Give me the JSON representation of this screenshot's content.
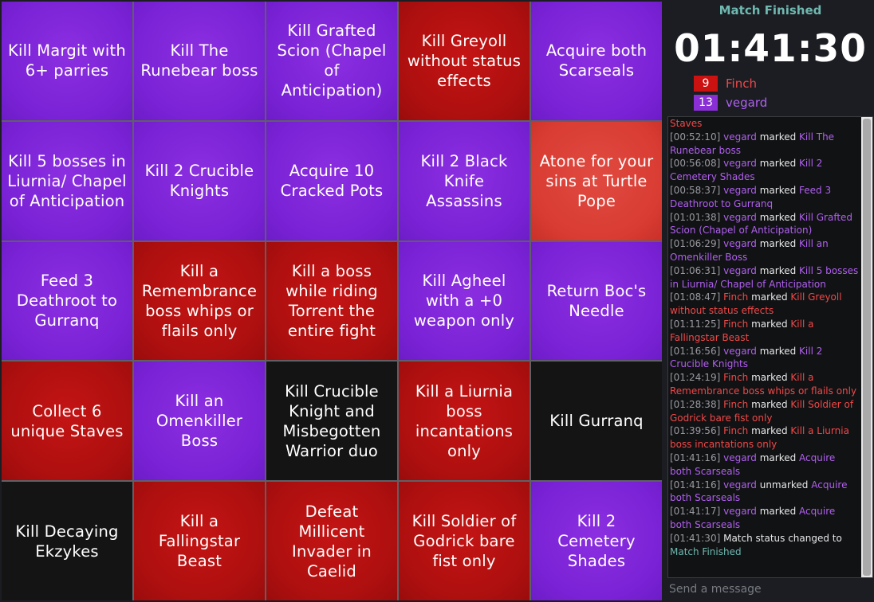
{
  "board": {
    "cells": [
      {
        "text": "Kill Margit with 6+ parries",
        "color": "purple"
      },
      {
        "text": "Kill The Runebear boss",
        "color": "purple"
      },
      {
        "text": "Kill Grafted Scion (Chapel of Anticipation)",
        "color": "purple"
      },
      {
        "text": "Kill Greyoll without status effects",
        "color": "red"
      },
      {
        "text": "Acquire both Scarseals",
        "color": "purple"
      },
      {
        "text": "Kill 5 bosses in Liurnia/ Chapel of Anticipation",
        "color": "purple"
      },
      {
        "text": "Kill 2 Crucible Knights",
        "color": "purple"
      },
      {
        "text": "Acquire 10 Cracked Pots",
        "color": "purple"
      },
      {
        "text": "Kill 2 Black Knife Assassins",
        "color": "purple"
      },
      {
        "text": "Atone for your sins at Turtle Pope",
        "color": "red-light"
      },
      {
        "text": "Feed 3 Deathroot to Gurranq",
        "color": "purple"
      },
      {
        "text": "Kill a Remembrance boss whips or flails only",
        "color": "red"
      },
      {
        "text": "Kill a boss while riding Torrent the entire fight",
        "color": "red"
      },
      {
        "text": "Kill Agheel with a +0 weapon only",
        "color": "purple"
      },
      {
        "text": "Return Boc's Needle",
        "color": "purple"
      },
      {
        "text": "Collect 6 unique Staves",
        "color": "red"
      },
      {
        "text": "Kill an Omenkiller Boss",
        "color": "purple"
      },
      {
        "text": "Kill Crucible Knight and Misbegotten Warrior duo",
        "color": "dark"
      },
      {
        "text": "Kill a Liurnia boss incantations only",
        "color": "red"
      },
      {
        "text": "Kill Gurranq",
        "color": "dark"
      },
      {
        "text": "Kill Decaying Ekzykes",
        "color": "dark"
      },
      {
        "text": "Kill a Fallingstar Beast",
        "color": "red"
      },
      {
        "text": "Defeat Millicent Invader in Caelid",
        "color": "red"
      },
      {
        "text": "Kill Soldier of Godrick bare fist only",
        "color": "red"
      },
      {
        "text": "Kill 2 Cemetery Shades",
        "color": "purple"
      }
    ]
  },
  "sidebar": {
    "status": "Match Finished",
    "timer": "01:41:30",
    "players": [
      {
        "score": "9",
        "name": "Finch",
        "color": "#cc1111"
      },
      {
        "score": "13",
        "name": "vegard",
        "color": "#8a2fd6"
      }
    ],
    "chat_placeholder": "Send a message"
  },
  "log": [
    {
      "time": "",
      "player": "",
      "pcolor": "",
      "action": "",
      "goal": "Staves",
      "gcolor": "f"
    },
    {
      "time": "[00:52:10]",
      "player": "vegard",
      "pcolor": "v",
      "action": "marked",
      "goal": "Kill The Runebear boss",
      "gcolor": "v"
    },
    {
      "time": "[00:56:08]",
      "player": "vegard",
      "pcolor": "v",
      "action": "marked",
      "goal": "Kill 2 Cemetery Shades",
      "gcolor": "v"
    },
    {
      "time": "[00:58:37]",
      "player": "vegard",
      "pcolor": "v",
      "action": "marked",
      "goal": "Feed 3 Deathroot to Gurranq",
      "gcolor": "v"
    },
    {
      "time": "[01:01:38]",
      "player": "vegard",
      "pcolor": "v",
      "action": "marked",
      "goal": "Kill Grafted Scion (Chapel of Anticipation)",
      "gcolor": "v"
    },
    {
      "time": "[01:06:29]",
      "player": "vegard",
      "pcolor": "v",
      "action": "marked",
      "goal": "Kill an Omenkiller Boss",
      "gcolor": "v"
    },
    {
      "time": "[01:06:31]",
      "player": "vegard",
      "pcolor": "v",
      "action": "marked",
      "goal": "Kill 5 bosses in Liurnia/ Chapel of Anticipation",
      "gcolor": "v"
    },
    {
      "time": "[01:08:47]",
      "player": "Finch",
      "pcolor": "f",
      "action": "marked",
      "goal": "Kill Greyoll without status effects",
      "gcolor": "f"
    },
    {
      "time": "[01:11:25]",
      "player": "Finch",
      "pcolor": "f",
      "action": "marked",
      "goal": "Kill a Fallingstar Beast",
      "gcolor": "f"
    },
    {
      "time": "[01:16:56]",
      "player": "vegard",
      "pcolor": "v",
      "action": "marked",
      "goal": "Kill 2 Crucible Knights",
      "gcolor": "v"
    },
    {
      "time": "[01:24:19]",
      "player": "Finch",
      "pcolor": "f",
      "action": "marked",
      "goal": "Kill a Remembrance boss whips or flails only",
      "gcolor": "f"
    },
    {
      "time": "[01:28:38]",
      "player": "Finch",
      "pcolor": "f",
      "action": "marked",
      "goal": "Kill Soldier of Godrick bare fist only",
      "gcolor": "f"
    },
    {
      "time": "[01:39:56]",
      "player": "Finch",
      "pcolor": "f",
      "action": "marked",
      "goal": "Kill a Liurnia boss incantations only",
      "gcolor": "f"
    },
    {
      "time": "[01:41:16]",
      "player": "vegard",
      "pcolor": "v",
      "action": "marked",
      "goal": "Acquire both Scarseals",
      "gcolor": "v"
    },
    {
      "time": "[01:41:16]",
      "player": "vegard",
      "pcolor": "v",
      "action": "unmarked",
      "goal": "Acquire both Scarseals",
      "gcolor": "v"
    },
    {
      "time": "[01:41:17]",
      "player": "vegard",
      "pcolor": "v",
      "action": "marked",
      "goal": "Acquire both Scarseals",
      "gcolor": "v"
    },
    {
      "time": "[01:41:30]",
      "player": "",
      "pcolor": "",
      "action": "Match status changed to",
      "goal": "Match Finished",
      "gcolor": "s"
    }
  ]
}
